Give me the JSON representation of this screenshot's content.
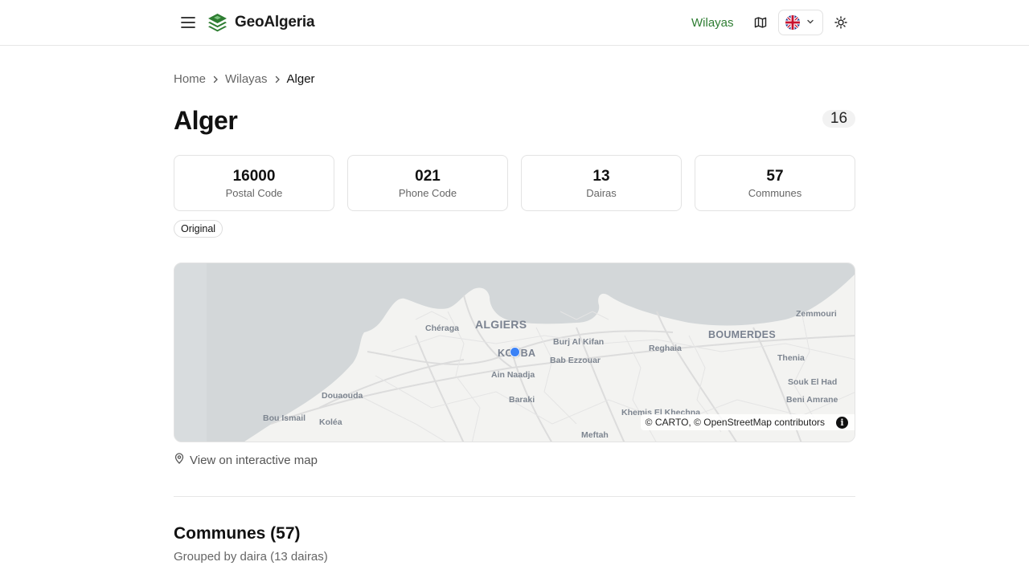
{
  "header": {
    "brand": "GeoAlgeria",
    "nav_wilayas": "Wilayas",
    "accent_color": "#2e7d32",
    "icons": [
      "menu-icon",
      "layers-logo-icon",
      "map-icon",
      "uk-flag-icon",
      "chevron-down-icon",
      "sun-icon"
    ]
  },
  "breadcrumb": {
    "home": "Home",
    "wilayas": "Wilayas",
    "current": "Alger"
  },
  "page": {
    "title": "Alger",
    "wilaya_code": "16"
  },
  "stats": [
    {
      "value": "16000",
      "label": "Postal Code"
    },
    {
      "value": "021",
      "label": "Phone Code"
    },
    {
      "value": "13",
      "label": "Dairas"
    },
    {
      "value": "57",
      "label": "Communes"
    }
  ],
  "tag": "Original",
  "map": {
    "labels": {
      "algiers": "ALGIERS",
      "boumerdes": "BOUMERDES",
      "kouba": "KOUBA",
      "cheraga": "Chéraga",
      "burj": "Burj Al Kifan",
      "reghaia": "Reghaia",
      "zemmouri": "Zemmouri",
      "bab_ezzouar": "Bab Ezzouar",
      "ain_naadja": "Ain Naadja",
      "thenia": "Thenia",
      "souk_el_had": "Souk El Had",
      "douaouda": "Douaouda",
      "baraki": "Baraki",
      "beni_amrane": "Beni Amrane",
      "bou_ismail": "Bou Ismail",
      "kolea": "Koléa",
      "khemis": "Khemis El Khechna",
      "meftah": "Meftah"
    },
    "attribution": "© CARTO, © OpenStreetMap contributors",
    "marker_color": "#3b82f6"
  },
  "map_link": "View on interactive map",
  "communes_section": {
    "title": "Communes (57)",
    "subtitle": "Grouped by daira (13 dairas)"
  }
}
